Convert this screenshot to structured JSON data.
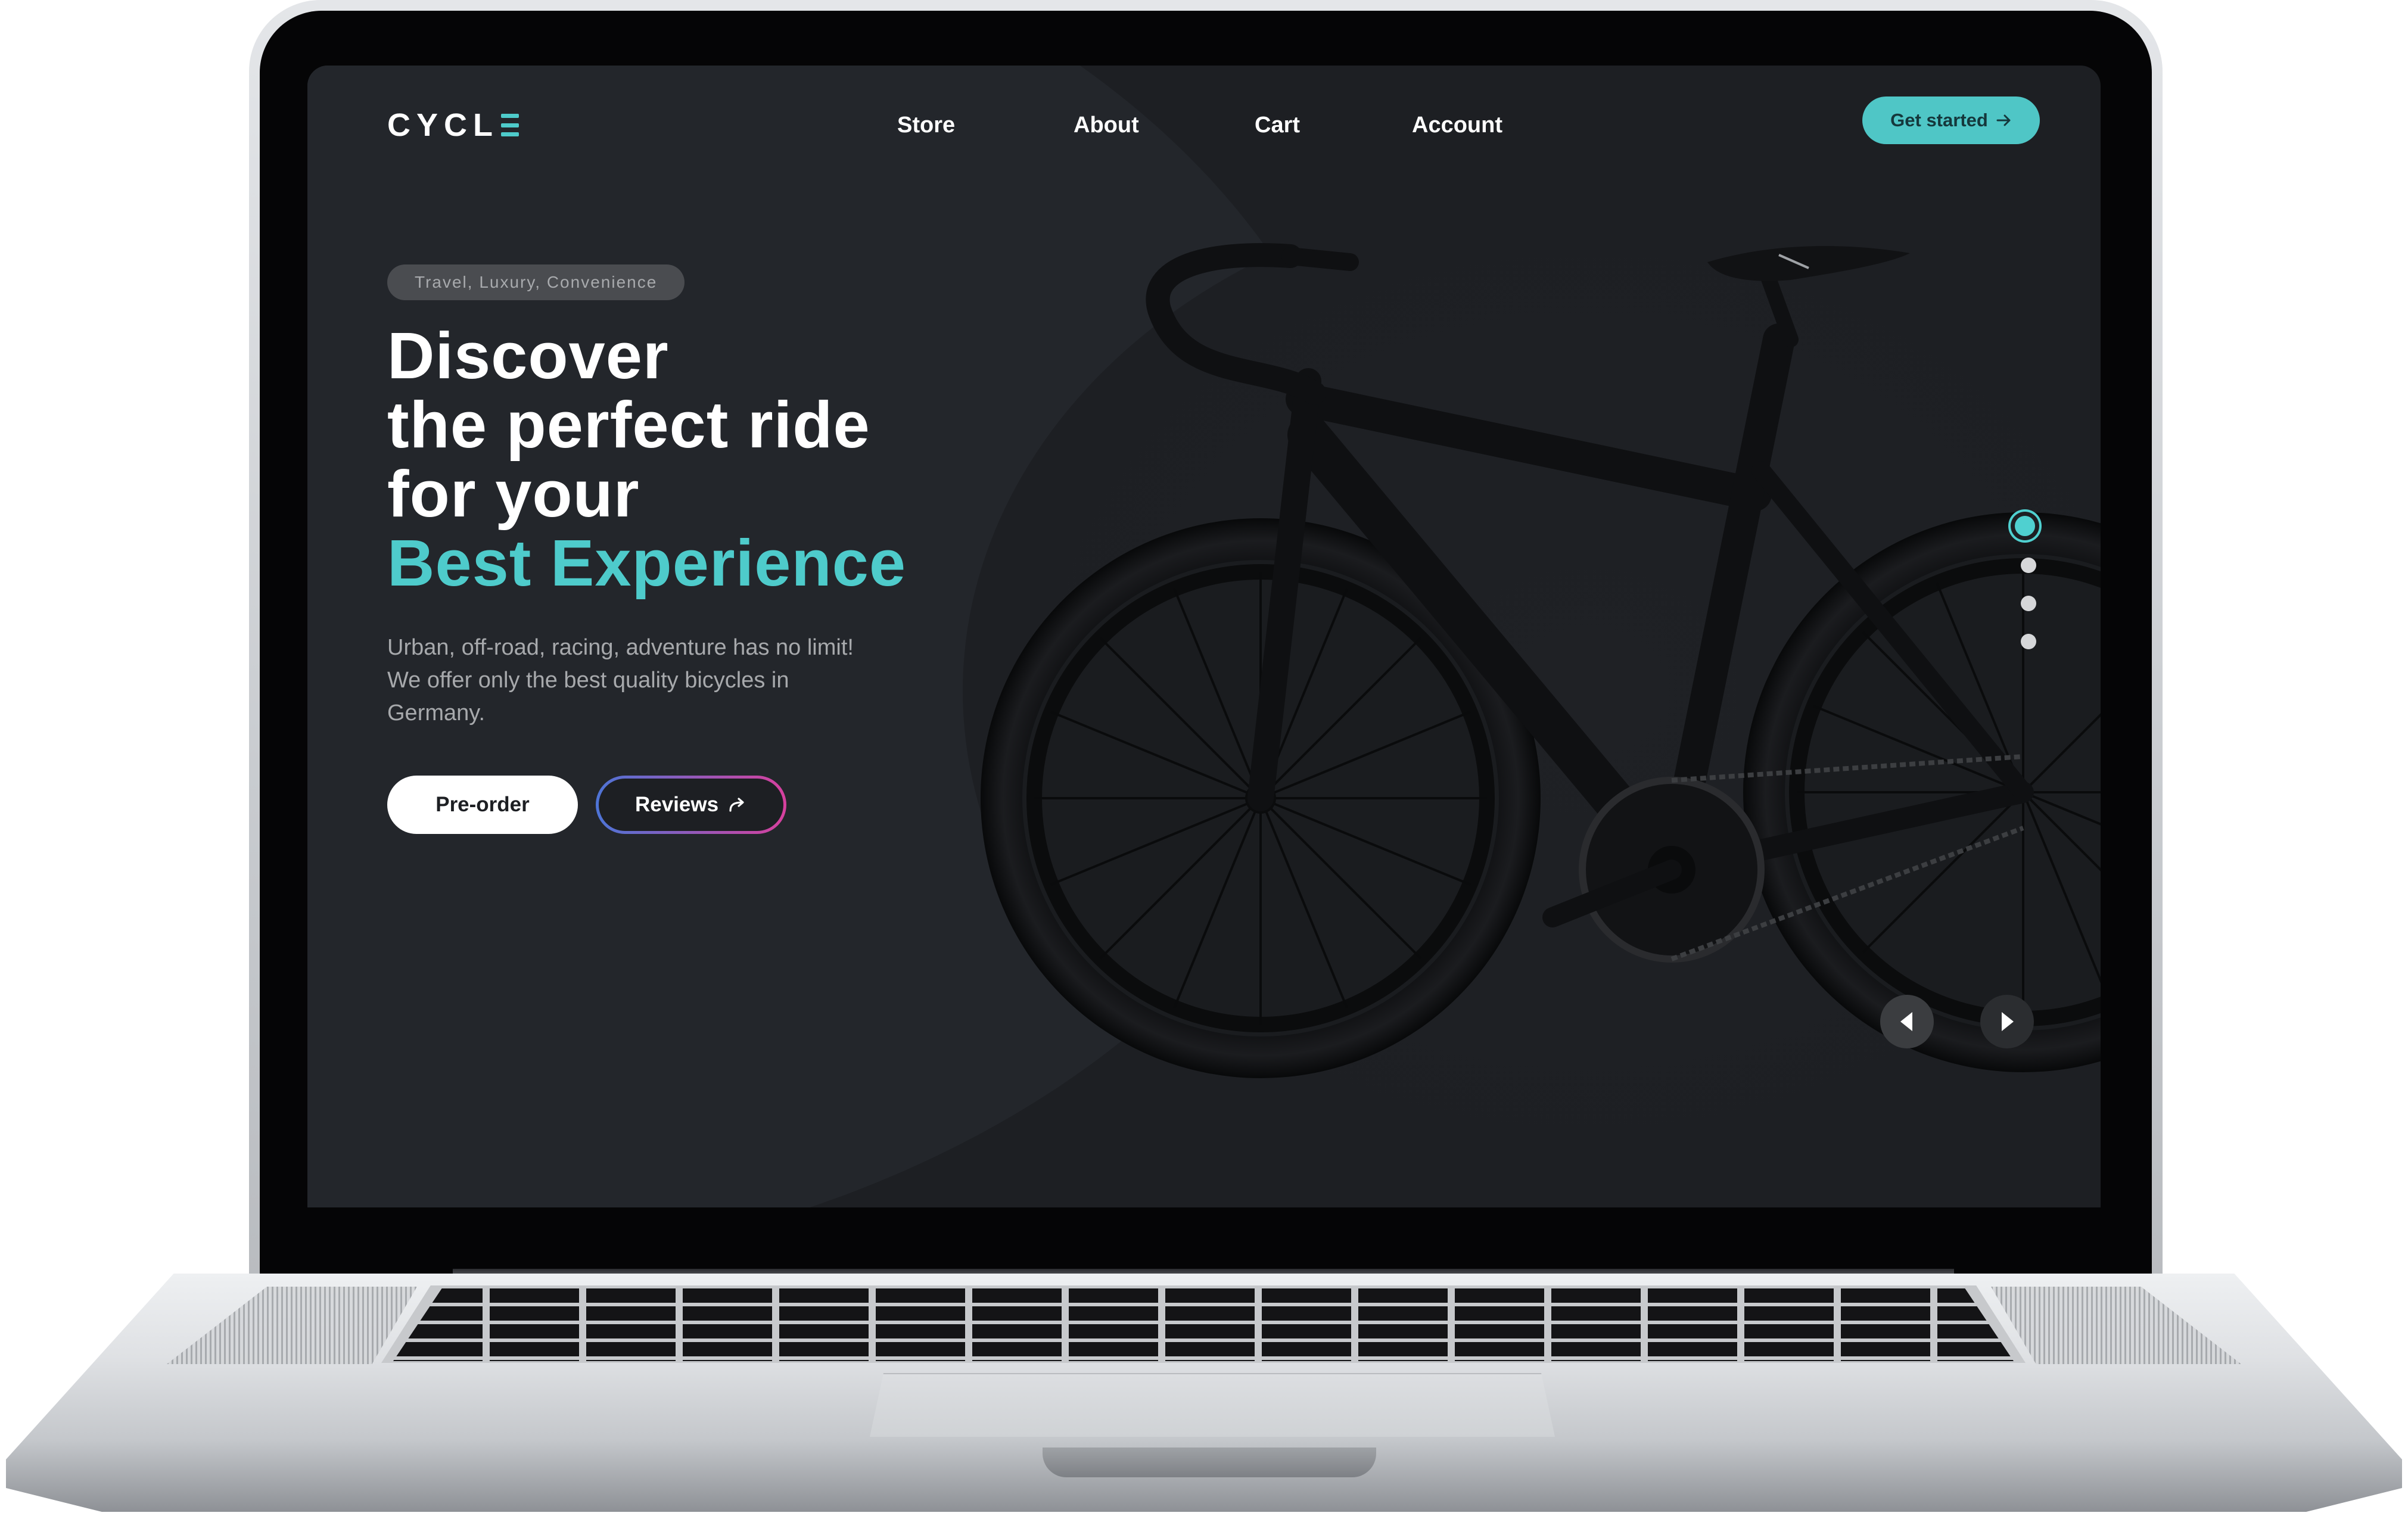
{
  "brand": {
    "logo_text": "CYCL"
  },
  "nav": {
    "links": [
      "Store",
      "About",
      "Cart",
      "Account"
    ],
    "cta_label": "Get started",
    "cta_icon": "arrow-right-icon"
  },
  "hero": {
    "tag": "Travel, Luxury, Convenience",
    "headline_lines": [
      "Discover",
      "the perfect ride",
      "for your"
    ],
    "headline_accent": "Best Experience",
    "description": "Urban, off-road, racing, adventure has no limit! We offer only the best quality bicycles in Germany.",
    "primary_button": "Pre-order",
    "secondary_button": "Reviews",
    "secondary_icon": "share-arrow-icon"
  },
  "carousel": {
    "slide_count": 4,
    "active_index": 0,
    "prev_icon": "caret-left-icon",
    "next_icon": "caret-right-icon"
  },
  "colors": {
    "accent": "#4ecbcb",
    "background": "#1d1f23",
    "reviews_gradient_start": "#4d74d6",
    "reviews_gradient_end": "#d7409e"
  }
}
